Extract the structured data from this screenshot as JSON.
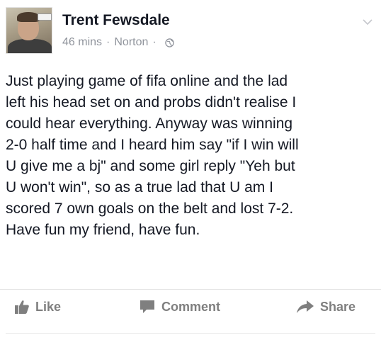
{
  "post": {
    "author": "Trent Fewsdale",
    "time": "46 mins",
    "separator": "·",
    "location": "Norton",
    "separator2": "·",
    "privacy_icon": "globe-icon",
    "menu_icon": "chevron-down-icon",
    "text": "Just playing game of fifa online and the lad\nleft his head set on and probs didn't realise I\ncould hear everything. Anyway was winning\n2-0 half time and I heard him say \"if I win will\nU give me a bj\" and some girl reply \"Yeh but\nU won't win\", so as a true lad that U am I\nscored 7 own goals on the belt and lost 7-2.\nHave fun my friend, have fun."
  },
  "actions": {
    "like_label": "Like",
    "like_icon": "thumbs-up-icon",
    "comment_label": "Comment",
    "comment_icon": "speech-bubble-icon",
    "share_label": "Share",
    "share_icon": "share-arrow-icon"
  },
  "colors": {
    "text": "#141823",
    "meta": "#90949c",
    "action": "#7f7f7f"
  }
}
